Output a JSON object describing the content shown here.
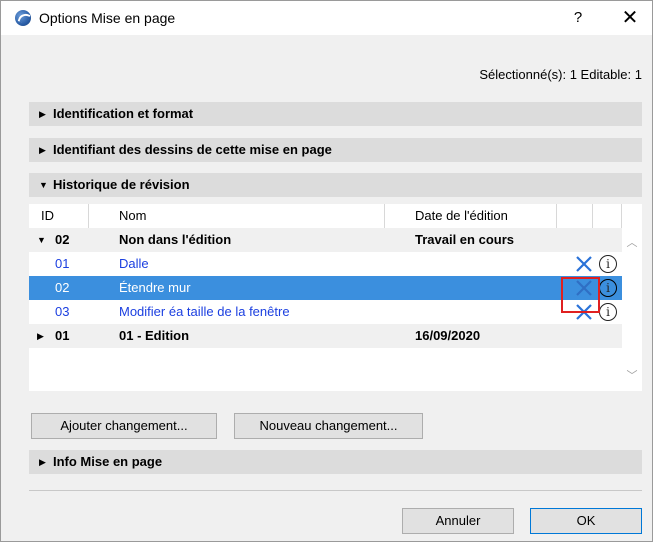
{
  "window": {
    "title": "Options Mise en page",
    "help_label": "?",
    "close_label": "✕"
  },
  "selection_info": "Sélectionné(s): 1 Editable: 1",
  "sections": {
    "identification": "Identification et format",
    "drawing_ids": "Identifiant des dessins de cette mise en page",
    "revision_history": "Historique de révision",
    "layout_info": "Info Mise en page"
  },
  "table": {
    "columns": [
      "ID",
      "Nom",
      "Date de l'édition"
    ],
    "groups": [
      {
        "id": "02",
        "name": "Non dans l'édition",
        "date": "Travail en cours",
        "expanded": true,
        "children": [
          {
            "id": "01",
            "name": "Dalle",
            "selected": false
          },
          {
            "id": "02",
            "name": "Étendre mur",
            "selected": true
          },
          {
            "id": "03",
            "name": "Modifier éa taille de la fenêtre",
            "selected": false
          }
        ]
      },
      {
        "id": "01",
        "name": "01 - Edition",
        "date": "16/09/2020",
        "expanded": false
      }
    ]
  },
  "buttons": {
    "add_change": "Ajouter changement...",
    "new_change": "Nouveau changement...",
    "cancel": "Annuler",
    "ok": "OK"
  },
  "colors": {
    "selection": "#3b8fde",
    "link_text": "#1b3fe0",
    "delete_icon": "#2a72d8",
    "highlight": "#e02020"
  }
}
